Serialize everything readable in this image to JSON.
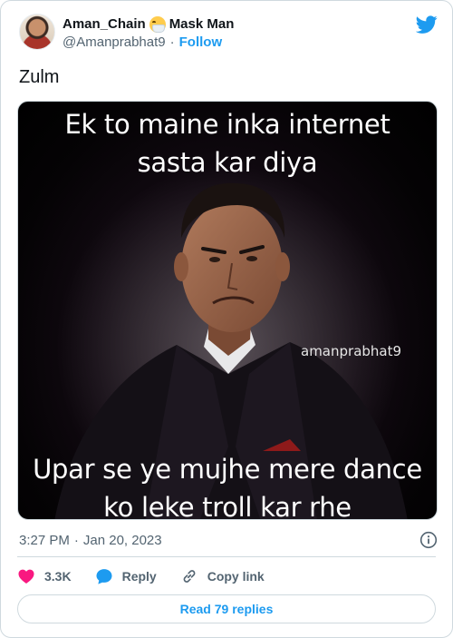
{
  "author": {
    "display_name": "Aman_Chain",
    "display_name_suffix": "Mask Man",
    "emoji_icon": "face-with-medical-mask-emoji",
    "handle": "@Amanprabhat9",
    "separator": "·",
    "follow_label": "Follow"
  },
  "tweet": {
    "text": "Zulm"
  },
  "media": {
    "caption_top_line1": "Ek to maine inka internet",
    "caption_top_line2": "sasta kar diya",
    "caption_bottom_line1": "Upar se ye mujhe mere dance",
    "caption_bottom_line2": "ko leke troll kar rhe",
    "watermark": "amanprabhat9"
  },
  "meta": {
    "time": "3:27 PM",
    "separator": "·",
    "date": "Jan 20, 2023"
  },
  "actions": {
    "likes": "3.3K",
    "reply_label": "Reply",
    "copy_link_label": "Copy link"
  },
  "footer": {
    "read_replies_label": "Read 79 replies"
  },
  "colors": {
    "brand_blue": "#1d9bf0",
    "like_pink": "#f91880",
    "secondary_text": "#536471",
    "primary_text": "#0f1419",
    "border": "#cfd9de"
  }
}
